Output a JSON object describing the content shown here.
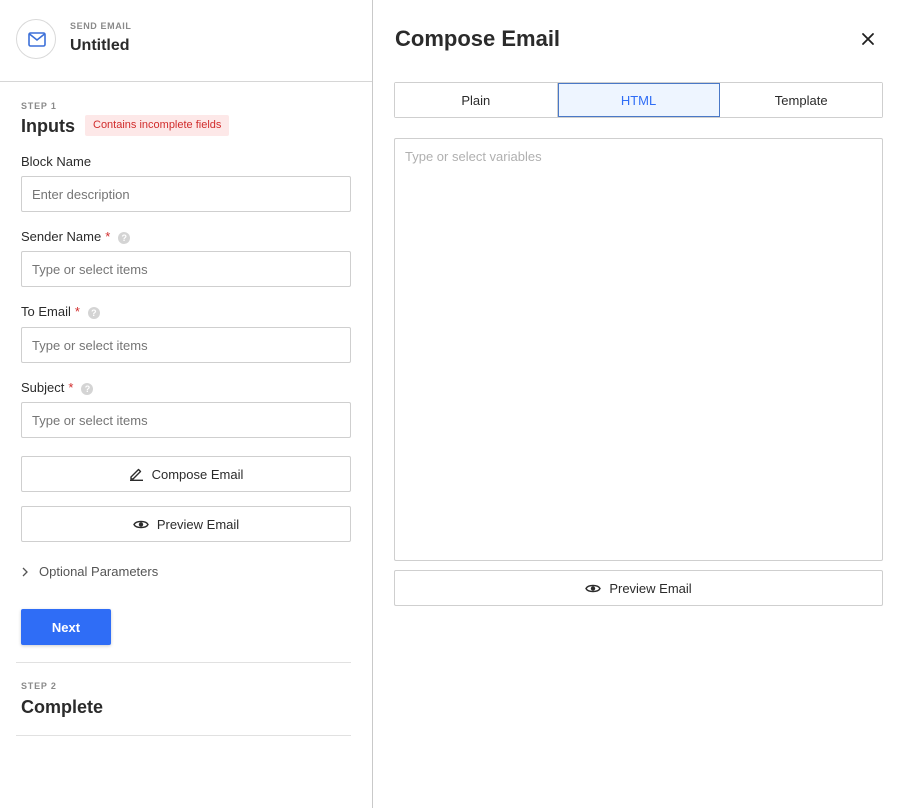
{
  "header": {
    "kicker": "SEND EMAIL",
    "title": "Untitled",
    "icon": "mail-icon"
  },
  "step1": {
    "label": "STEP 1",
    "title": "Inputs",
    "badge": "Contains incomplete fields"
  },
  "fields": {
    "block_name": {
      "label": "Block Name",
      "placeholder": "Enter description"
    },
    "sender_name": {
      "label": "Sender Name",
      "required": "*",
      "placeholder": "Type or select items"
    },
    "to_email": {
      "label": "To Email",
      "required": "*",
      "placeholder": "Type or select items"
    },
    "subject": {
      "label": "Subject",
      "required": "*",
      "placeholder": "Type or select items"
    }
  },
  "buttons": {
    "compose": "Compose Email",
    "preview": "Preview Email",
    "next": "Next"
  },
  "optional": {
    "label": "Optional Parameters"
  },
  "step2": {
    "label": "STEP 2",
    "title": "Complete"
  },
  "compose_panel": {
    "title": "Compose Email",
    "tabs": [
      {
        "label": "Plain",
        "active": false
      },
      {
        "label": "HTML",
        "active": true
      },
      {
        "label": "Template",
        "active": false
      }
    ],
    "editor_placeholder": "Type or select variables",
    "preview_button": "Preview Email"
  },
  "colors": {
    "primary": "#2f6df6",
    "required": "#d12c2c",
    "badge_bg": "#fde8e8",
    "active_tab_bg": "#eef5ff"
  }
}
